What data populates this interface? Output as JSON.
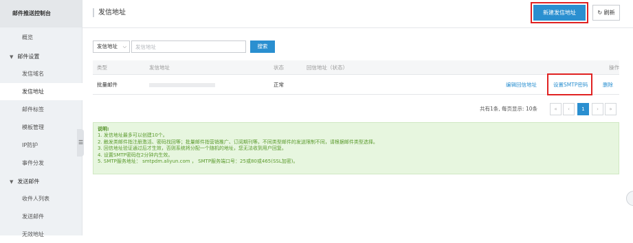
{
  "sidebar": {
    "title": "邮件推送控制台",
    "items": [
      {
        "type": "item",
        "label": "概览",
        "active": false
      },
      {
        "type": "group",
        "label": "邮件设置"
      },
      {
        "type": "item",
        "label": "发信域名",
        "active": false
      },
      {
        "type": "item",
        "label": "发信地址",
        "active": true
      },
      {
        "type": "item",
        "label": "邮件标签",
        "active": false
      },
      {
        "type": "item",
        "label": "模板管理",
        "active": false
      },
      {
        "type": "item",
        "label": "IP防护",
        "active": false
      },
      {
        "type": "item",
        "label": "事件分发",
        "active": false
      },
      {
        "type": "group",
        "label": "发送邮件"
      },
      {
        "type": "item",
        "label": "收件人列表",
        "active": false
      },
      {
        "type": "item",
        "label": "发送邮件",
        "active": false
      },
      {
        "type": "item",
        "label": "无效地址",
        "active": false
      }
    ]
  },
  "header": {
    "title": "发信地址",
    "new_button": "新建发信地址",
    "refresh_icon": "↻",
    "refresh_label": "刷新"
  },
  "filter": {
    "select_value": "发信地址",
    "input_placeholder": "发信地址",
    "search_button": "搜索"
  },
  "table": {
    "headers": {
      "type": "类型",
      "address": "发信地址",
      "status": "状态",
      "reply": "回信地址（状态）",
      "ops": "操作"
    },
    "rows": [
      {
        "type": "批量邮件",
        "status": "正常",
        "op_edit_reply": "编辑回信地址",
        "op_set_smtp": "设置SMTP密码",
        "op_delete": "删除"
      }
    ]
  },
  "pagination": {
    "summary": "共有1条, 每页显示: 10条",
    "first": "«",
    "prev": "‹",
    "current": "1",
    "next": "›",
    "last": "»"
  },
  "notice": {
    "title": "说明:",
    "lines": [
      "1. 发信地址最多可以创建10个。",
      "2. 触发类邮件指注册激活、密码找回等；批量邮件指营销推广、订阅期刊等。不同类型邮件的发送限制不同，请根据邮件类型选择。",
      "3. 回信地址验证通过后才生效，否则系统将分配一个随机的地址，您无法收到用户回复。",
      "4. 设置SMTP密码在2分钟内生效。",
      "5. SMTP服务地址： smtpdm.aliyun.com ， SMTP服务端口号：25或80或465(SSL加密)。"
    ]
  },
  "colors": {
    "primary": "#2a8fd0",
    "highlight": "#e02020",
    "notice_bg": "#e7f6df",
    "notice_text": "#5a9a2c"
  }
}
